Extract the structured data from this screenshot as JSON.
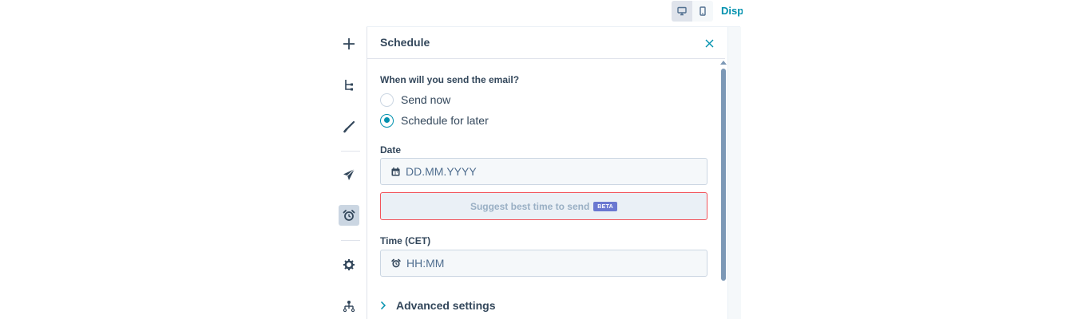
{
  "topbar": {
    "view_modes": [
      {
        "name": "desktop",
        "icon": "monitor-icon",
        "active": true
      },
      {
        "name": "mobile",
        "icon": "mobile-icon",
        "active": false
      }
    ],
    "link_text": "Disp"
  },
  "rail": {
    "items": [
      {
        "icon": "plus-icon",
        "active": false
      },
      {
        "icon": "tree-structure-icon",
        "active": false
      },
      {
        "icon": "brush-icon",
        "active": false
      },
      {
        "icon": "send-icon",
        "active": false
      },
      {
        "icon": "alarm-clock-icon",
        "active": true
      },
      {
        "icon": "gear-icon",
        "active": false
      },
      {
        "icon": "hierarchy-icon",
        "active": false
      }
    ]
  },
  "panel": {
    "title": "Schedule",
    "question": "When will you send the email?",
    "options": [
      {
        "label": "Send now",
        "checked": false
      },
      {
        "label": "Schedule for later",
        "checked": true
      }
    ],
    "date_label": "Date",
    "date_placeholder": "DD.MM.YYYY",
    "suggest_label": "Suggest best time to send",
    "beta_badge": "BETA",
    "time_label": "Time (CET)",
    "time_placeholder": "HH:MM",
    "advanced_label": "Advanced settings"
  },
  "colors": {
    "accent": "#0091ae",
    "error_border": "#f2545b",
    "beta_badge": "#6a78d1",
    "text": "#33475b"
  }
}
